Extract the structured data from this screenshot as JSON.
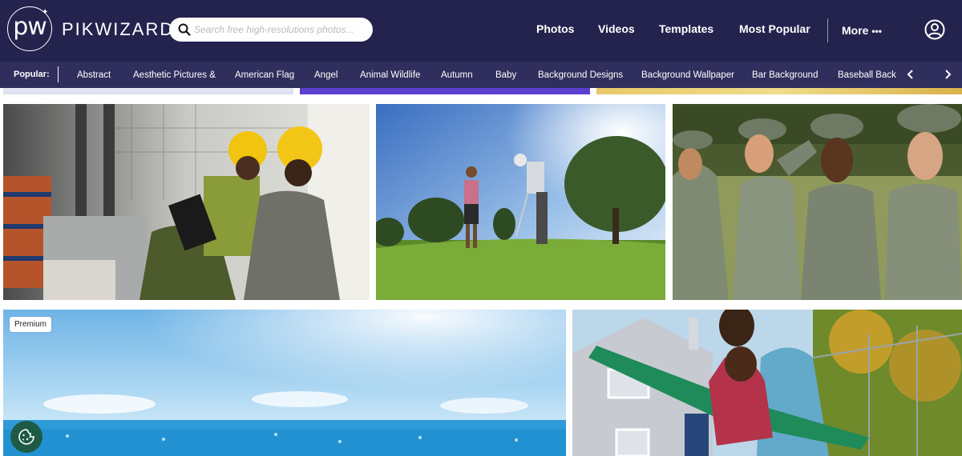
{
  "brand": {
    "logo_mark": "pw",
    "name": "PIKWIZARD"
  },
  "search": {
    "placeholder": "Search free high-resolutions photos..."
  },
  "nav": {
    "photos": "Photos",
    "videos": "Videos",
    "templates": "Templates",
    "most_popular": "Most Popular",
    "more": "More",
    "more_icon": "ellipsis-icon",
    "account_icon": "user-circle-icon"
  },
  "categories": {
    "label": "Popular:",
    "items": [
      "Abstract",
      "Aesthetic Pictures &",
      "American Flag",
      "Angel",
      "Animal Wildlife",
      "Autumn",
      "Baby",
      "Background Designs",
      "Background Wallpaper",
      "Bar Background",
      "Baseball Back"
    ],
    "prev_icon": "chevron-left-icon",
    "next_icon": "chevron-right-icon"
  },
  "photos": {
    "premium_badge": "Premium"
  },
  "cookie": {
    "icon": "cookie-icon"
  },
  "colors": {
    "header_bg": "#24234e",
    "category_bar_bg": "#2f2e5c",
    "accent_purple": "#5b3fd1",
    "cookie_green": "#1f5a45"
  }
}
